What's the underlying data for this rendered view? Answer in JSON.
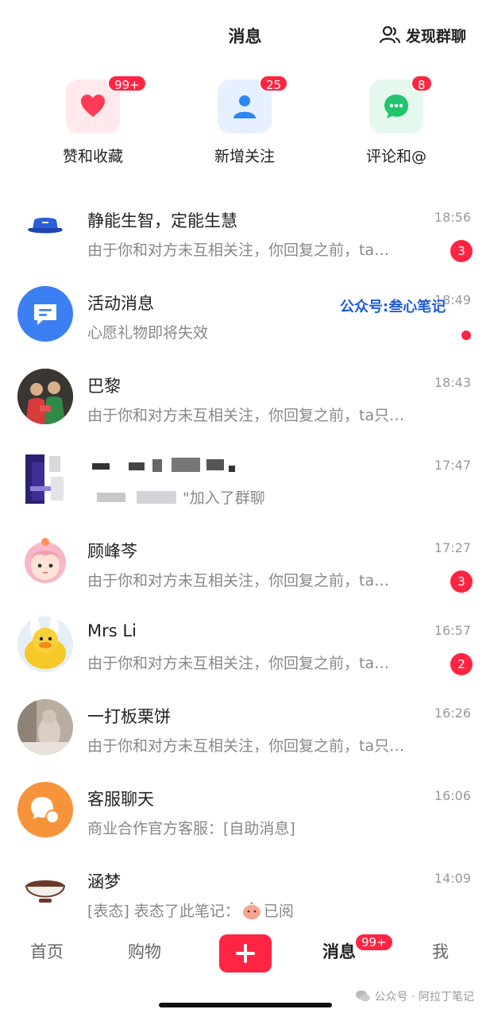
{
  "header": {
    "title": "消息",
    "discover_label": "发现群聊",
    "discover_icon": "group-user-icon"
  },
  "shortcuts": [
    {
      "label": "赞和收藏",
      "badge": "99+",
      "icon": "heart-icon",
      "color": "#ff2442",
      "bg": "#ffe9ec"
    },
    {
      "label": "新增关注",
      "badge": "25",
      "icon": "user-icon",
      "color": "#2f86f6",
      "bg": "#e6f0ff"
    },
    {
      "label": "评论和@",
      "badge": "8",
      "icon": "chat-bubble-icon",
      "color": "#21c56c",
      "bg": "#e5f8ee"
    }
  ],
  "conversations": [
    {
      "name": "静能生智，定能生慧",
      "time": "18:56",
      "preview": "由于你和对方未互相关注，你回复之前，ta…",
      "unread": "3",
      "avatar": "bucket-hat-avatar"
    },
    {
      "name": "活动消息",
      "time": "18:49",
      "preview": "心愿礼物即将失效",
      "unread_dot": true,
      "avatar": "activity-message-icon"
    },
    {
      "name": "巴黎",
      "time": "18:43",
      "preview": "由于你和对方未互相关注，你回复之前，ta只…",
      "avatar": "photo-avatar"
    },
    {
      "name": "",
      "time": "17:47",
      "preview": "\"加入了群聊",
      "avatar": "pixelated-avatar"
    },
    {
      "name": "顾峰芩",
      "time": "17:27",
      "preview": "由于你和对方未互相关注，你回复之前，ta…",
      "unread": "3",
      "avatar": "anime-girl-avatar"
    },
    {
      "name": "Mrs Li",
      "time": "16:57",
      "preview": "由于你和对方未互相关注，你回复之前，ta…",
      "unread": "2",
      "avatar": "duck-avatar"
    },
    {
      "name": "一打板栗饼",
      "time": "16:26",
      "preview": "由于你和对方未互相关注，你回复之前，ta只…",
      "avatar": "cat-photo-avatar"
    },
    {
      "name": "客服聊天",
      "time": "16:06",
      "preview": "商业合作官方客服：[自助消息]",
      "avatar": "customer-service-icon"
    },
    {
      "name": "涵梦",
      "time": "14:09",
      "preview": "[表态] 表态了此笔记：",
      "preview_tail": "已阅",
      "avatar": "bowl-avatar"
    }
  ],
  "overlay_watermark": "公众号:叁心笔记",
  "tabbar": {
    "tabs": [
      "首页",
      "购物",
      "消息",
      "我"
    ],
    "active": "消息",
    "message_badge": "99+"
  },
  "footer_watermark": "公众号 · 阿拉丁笔记",
  "colors": {
    "accent": "#ff2442",
    "watermark_blue": "#1f5cd6"
  }
}
